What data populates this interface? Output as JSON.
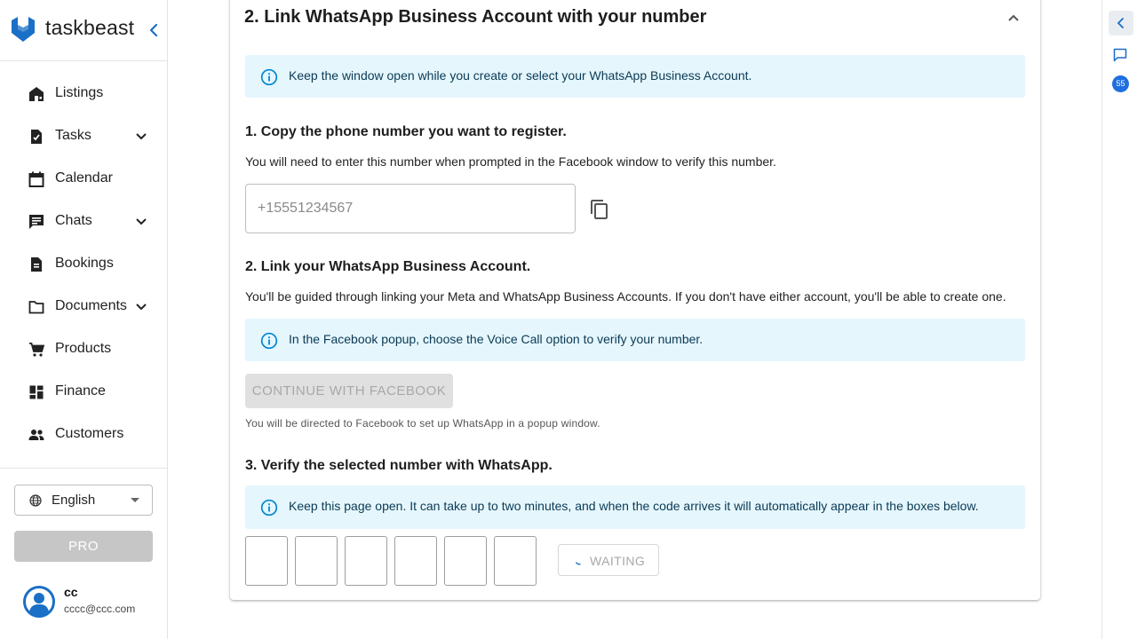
{
  "brand": {
    "name": "taskbeast"
  },
  "nav": {
    "items": [
      {
        "label": "Listings",
        "icon": "store-icon"
      },
      {
        "label": "Tasks",
        "icon": "task-check-icon",
        "expandable": true
      },
      {
        "label": "Calendar",
        "icon": "calendar-icon"
      },
      {
        "label": "Chats",
        "icon": "chat-icon",
        "expandable": true
      },
      {
        "label": "Bookings",
        "icon": "document-icon"
      },
      {
        "label": "Documents",
        "icon": "folder-icon",
        "expandable": true
      },
      {
        "label": "Products",
        "icon": "cart-icon"
      },
      {
        "label": "Finance",
        "icon": "dashboard-icon"
      },
      {
        "label": "Customers",
        "icon": "people-icon"
      }
    ]
  },
  "sidebar_footer": {
    "language": "English",
    "pro_label": "PRO",
    "user": {
      "name": "cc",
      "email": "cccc@ccc.com"
    }
  },
  "right_rail": {
    "badge_count": "55"
  },
  "section": {
    "title": "2. Link WhatsApp Business Account with your number",
    "info_top": "Keep the window open while you create or select your WhatsApp Business Account.",
    "step1": {
      "heading": "1. Copy the phone number you want to register.",
      "text": "You will need to enter this number when prompted in the Facebook window to verify this number.",
      "phone_placeholder": "+15551234567"
    },
    "step2": {
      "heading": "2. Link your WhatsApp Business Account.",
      "text": "You'll be guided through linking your Meta and WhatsApp Business Accounts. If you don't have either account, you'll be able to create one.",
      "info": "In the Facebook popup, choose the Voice Call option to verify your number.",
      "button_label": "CONTINUE WITH FACEBOOK",
      "caption": "You will be directed to Facebook to set up WhatsApp in a popup window."
    },
    "step3": {
      "heading": "3. Verify the selected number with WhatsApp.",
      "info": "Keep this page open. It can take up to two minutes, and when the code arrives it will automatically appear in the boxes below.",
      "waiting_label": "WAITING"
    }
  },
  "colors": {
    "brand": "#1a6fc6",
    "info_bg": "#e5f6fd",
    "info_icon": "#0288d1",
    "badge": "#1f6fe0"
  }
}
